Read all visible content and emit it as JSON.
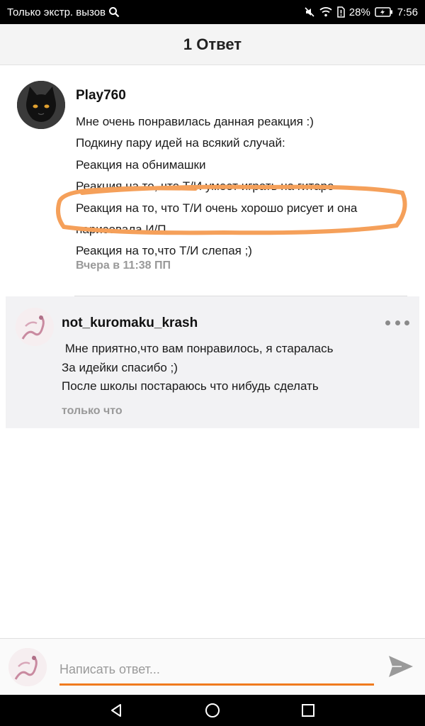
{
  "status_bar": {
    "carrier_text": "Только экстр. вызов",
    "battery_percent": "28%",
    "time": "7:56"
  },
  "header": {
    "title": "1 Ответ"
  },
  "comment": {
    "username": "Play760",
    "lines": [
      "Мне очень понравилась данная реакция :)",
      "Подкину пару идей на всякий случай:",
      "Реакция на обнимашки",
      "Реакция на то, что Т/И умеет играть на гитаре",
      "Реакция на то, что Т/И очень хорошо рисует и она",
      "нарисовала И/П",
      "Реакция на то,что Т/И слепая ;)"
    ],
    "timestamp": "Вчера в 11:38 ПП"
  },
  "reply": {
    "username": "not_kuromaku_krash",
    "lines": [
      " Мне приятно,что вам понравилось, я старалась",
      "За идейки спасибо ;)",
      "После школы постараюсь что нибудь сделать"
    ],
    "timestamp": "только что"
  },
  "reply_bar": {
    "placeholder": "Написать ответ..."
  },
  "colors": {
    "accent": "#f07b1e",
    "highlight": "#f5a05a"
  }
}
